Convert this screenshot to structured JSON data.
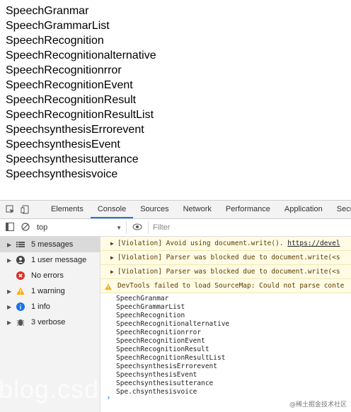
{
  "page": {
    "items": [
      "SpeechGranmar",
      "SpeechGrammarList",
      "SpeechRecognition",
      "SpeechRecognitionalternative",
      "SpeechRecognitionrror",
      "SpeechRecognitionEvent",
      "SpeechRecognitionResult",
      "SpeechRecognitionResultList",
      "SpeechsynthesisErrorevent",
      "SpeechsynthesisEvent",
      "Speechsynthesisutterance",
      "Speechsynthesisvoice"
    ]
  },
  "devtools": {
    "tabs": [
      "Elements",
      "Console",
      "Sources",
      "Network",
      "Performance",
      "Application",
      "Secu"
    ],
    "active_tab": "Console",
    "context": "top",
    "filter_placeholder": "Filter",
    "sidebar": [
      {
        "label": "5 messages",
        "icon": "list-icon",
        "caret": true,
        "selected": true
      },
      {
        "label": "1 user message",
        "icon": "user-icon",
        "caret": true,
        "selected": false
      },
      {
        "label": "No errors",
        "icon": "error-icon",
        "caret": false,
        "selected": false
      },
      {
        "label": "1 warning",
        "icon": "warning-icon",
        "caret": true,
        "selected": false
      },
      {
        "label": "1 info",
        "icon": "info-icon",
        "caret": true,
        "selected": false
      },
      {
        "label": "3 verbose",
        "icon": "verbose-icon",
        "caret": true,
        "selected": false
      }
    ],
    "messages": [
      {
        "text": "[Violation] Avoid using document.write(). ",
        "link": "https://devel"
      },
      {
        "text": "[Violation] Parser was blocked due to document.write(<s",
        "link": ""
      },
      {
        "text": "[Violation] Parser was blocked due to document.write(<s",
        "link": ""
      },
      {
        "text": "DevTools failed to load SourceMap: Could not parse conte",
        "link": ""
      }
    ],
    "log": [
      "SpeechGranmar",
      "SpeechGrammarList",
      "SpeechRecognition",
      "SpeechRecognitionalternative",
      "SpeechRecognitionrror",
      "SpeechRecognitionEvent",
      "SpeechRecognitionResult",
      "SpeechRecognitionResultList",
      "SpeechsynthesisErrorevent",
      "SpeechsynthesisEvent",
      "Speechsynthesisutterance",
      "Spe.chsynthesisvoice"
    ],
    "prompt": "›"
  },
  "watermark": {
    "left": "blog.csd",
    "right": "@稀土掘金技术社区"
  },
  "colors": {
    "accent": "#1a73e8",
    "warning_bg": "#fffbe5",
    "error": "#d93025",
    "warning": "#f9ab00",
    "info": "#1a73e8"
  }
}
